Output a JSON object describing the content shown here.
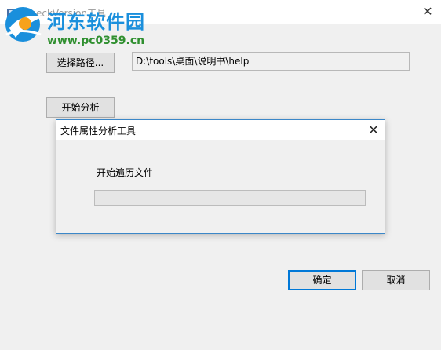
{
  "window": {
    "title": "CheckVersion工具",
    "close_icon": "close-icon"
  },
  "watermark": {
    "site_name": "河东软件园",
    "url": "www.pc0359.cn"
  },
  "main": {
    "select_path_label": "选择路径...",
    "path_value": "D:\\tools\\桌面\\说明书\\help",
    "start_analysis_label": "开始分析",
    "ok_label": "确定",
    "cancel_label": "取消"
  },
  "dialog": {
    "title": "文件属性分析工具",
    "status": "开始遍历文件",
    "progress": 0
  },
  "colors": {
    "accent": "#0078d7",
    "watermark_blue": "#1a8fdc",
    "watermark_green": "#2f8f2f"
  }
}
